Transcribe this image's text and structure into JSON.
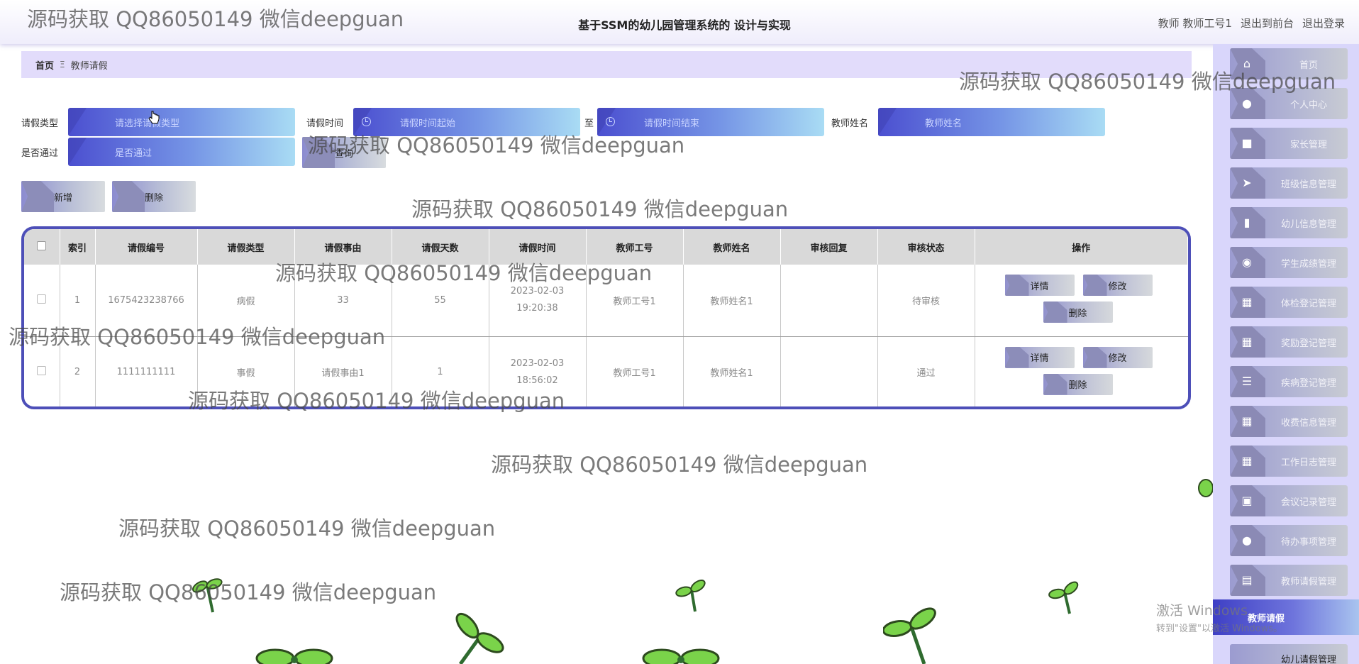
{
  "header": {
    "title": "基于SSM的幼儿园管理系统的 设计与实现",
    "user": "教师 教师工号1",
    "to_front": "退出到前台",
    "logout": "退出登录"
  },
  "breadcrumb": {
    "home": "首页",
    "separator": "Ξ",
    "current": "教师请假"
  },
  "search": {
    "type_label": "请假类型",
    "type_placeholder": "请选择请假类型",
    "time_label": "请假时间",
    "time_start_placeholder": "请假时间起始",
    "to_label": "至",
    "time_end_placeholder": "请假时间结束",
    "name_label": "教师姓名",
    "name_placeholder": "教师姓名",
    "pass_label": "是否通过",
    "pass_placeholder": "是否通过",
    "query_button": "查询"
  },
  "actions": {
    "add": "新增",
    "delete": "删除"
  },
  "table": {
    "columns": [
      "索引",
      "请假编号",
      "请假类型",
      "请假事由",
      "请假天数",
      "请假时间",
      "教师工号",
      "教师姓名",
      "审核回复",
      "审核状态",
      "操作"
    ],
    "rows": [
      {
        "index": "1",
        "code": "1675423238766",
        "type": "病假",
        "reason": "33",
        "days": "55",
        "time": "2023-02-03 19:20:38",
        "teacher_no": "教师工号1",
        "teacher_name": "教师姓名1",
        "reply": "",
        "status": "待审核"
      },
      {
        "index": "2",
        "code": "1111111111",
        "type": "事假",
        "reason": "请假事由1",
        "days": "1",
        "time": "2023-02-03 18:56:02",
        "teacher_no": "教师工号1",
        "teacher_name": "教师姓名1",
        "reply": "",
        "status": "通过"
      }
    ],
    "row_actions": {
      "detail": "详情",
      "edit": "修改",
      "delete": "删除"
    }
  },
  "sidebar": {
    "items": [
      {
        "label": "首页",
        "icon": "home-icon"
      },
      {
        "label": "个人中心",
        "icon": "user-icon"
      },
      {
        "label": "家长管理",
        "icon": "briefcase-icon"
      },
      {
        "label": "班级信息管理",
        "icon": "send-icon"
      },
      {
        "label": "幼儿信息管理",
        "icon": "bar-chart-icon"
      },
      {
        "label": "学生成绩管理",
        "icon": "bulb-icon"
      },
      {
        "label": "体检登记管理",
        "icon": "grid-icon"
      },
      {
        "label": "奖励登记管理",
        "icon": "grid-icon"
      },
      {
        "label": "疾病登记管理",
        "icon": "list-icon"
      },
      {
        "label": "收费信息管理",
        "icon": "grid-icon"
      },
      {
        "label": "工作日志管理",
        "icon": "table-icon"
      },
      {
        "label": "会议记录管理",
        "icon": "printer-icon"
      },
      {
        "label": "待办事项管理",
        "icon": "user-icon"
      },
      {
        "label": "教师请假管理",
        "icon": "clipboard-icon"
      }
    ],
    "active_sub": "教师请假",
    "next_sub": "幼儿请假管理"
  },
  "watermark": "源码获取 QQ86050149 微信deepguan",
  "activate_windows": {
    "line1": "激活 Windows",
    "line2": "转到\"设置\"以激活 Windows。"
  },
  "colors": {
    "accent": "#4d4fb8",
    "sidebar_bg": "#d9d6fb",
    "breadcrumb_bg": "#e2dcfb"
  }
}
